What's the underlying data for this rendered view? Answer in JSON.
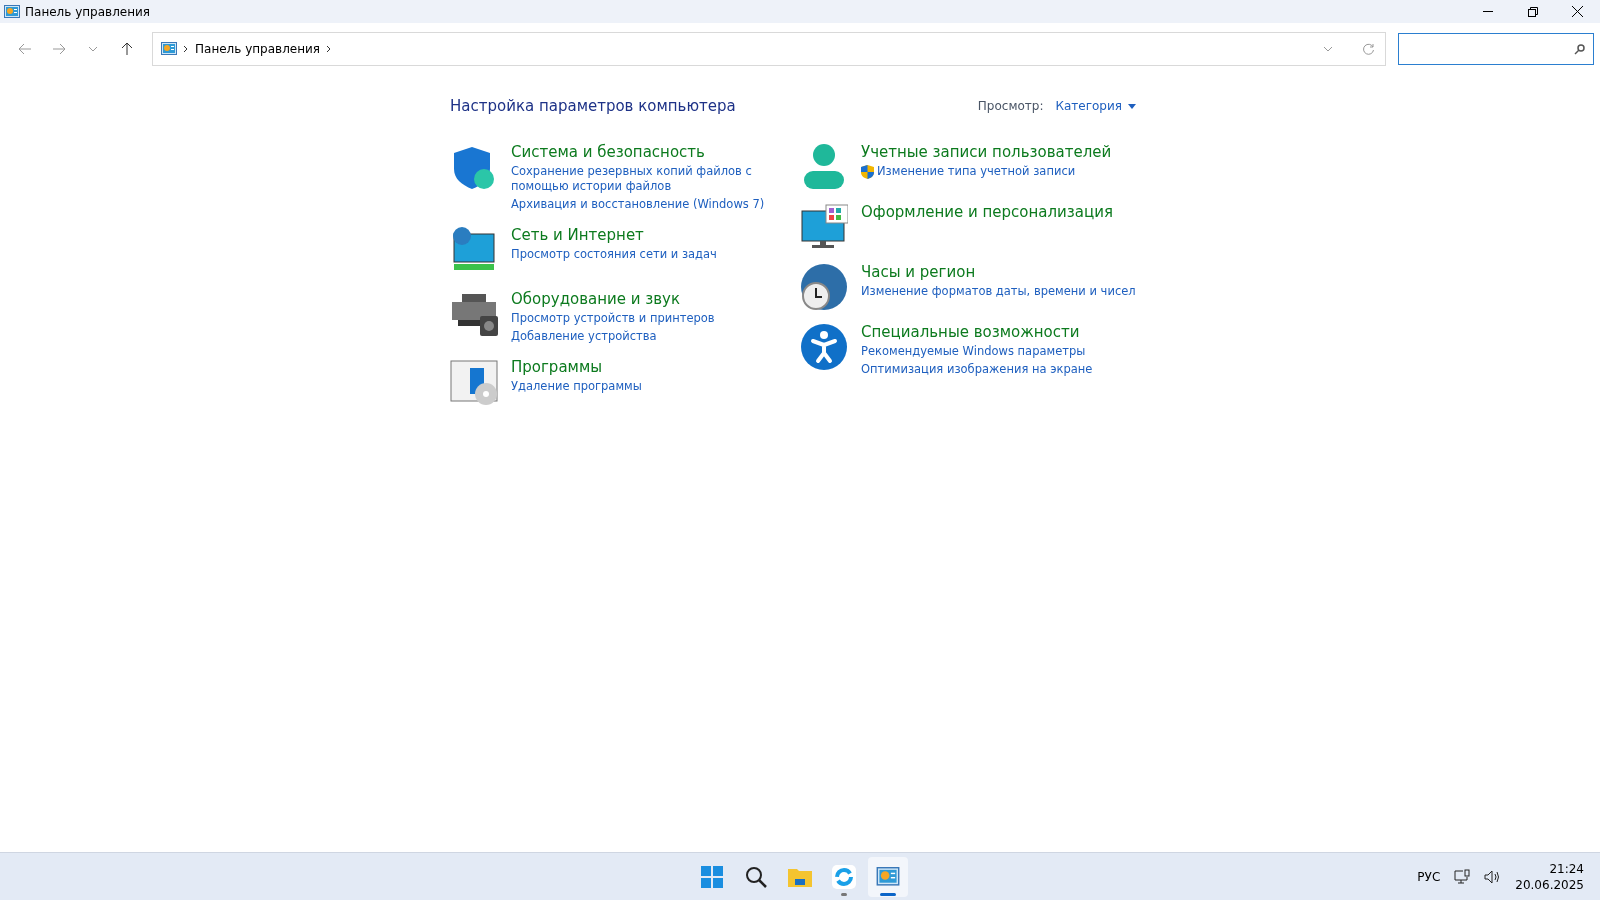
{
  "window": {
    "title": "Панель управления"
  },
  "address_bar": {
    "crumbs": [
      "Панель управления"
    ]
  },
  "heading": "Настройка параметров компьютера",
  "view": {
    "label": "Просмотр:",
    "value": "Категория"
  },
  "columns": [
    [
      {
        "title": "Система и безопасность",
        "links": [
          {
            "text": "Сохранение резервных копий файлов с помощью истории файлов",
            "shield": false
          },
          {
            "text": "Архивация и восстановление (Windows 7)",
            "shield": false
          }
        ]
      },
      {
        "title": "Сеть и Интернет",
        "links": [
          {
            "text": "Просмотр состояния сети и задач",
            "shield": false
          }
        ]
      },
      {
        "title": "Оборудование и звук",
        "links": [
          {
            "text": "Просмотр устройств и принтеров",
            "shield": false
          },
          {
            "text": "Добавление устройства",
            "shield": false
          }
        ]
      },
      {
        "title": "Программы",
        "links": [
          {
            "text": "Удаление программы",
            "shield": false
          }
        ]
      }
    ],
    [
      {
        "title": "Учетные записи пользователей",
        "links": [
          {
            "text": "Изменение типа учетной записи",
            "shield": true
          }
        ]
      },
      {
        "title": "Оформление и персонализация"
      },
      {
        "title": "Часы и регион",
        "links": [
          {
            "text": "Изменение форматов даты, времени и чисел",
            "shield": false
          }
        ]
      },
      {
        "title": "Специальные возможности",
        "links": [
          {
            "text": "Рекомендуемые Windows параметры",
            "shield": false
          },
          {
            "text": "Оптимизация изображения на экране",
            "shield": false
          }
        ]
      }
    ]
  ],
  "taskbar": {
    "apps": [
      {
        "running": false,
        "selected": false
      },
      {
        "running": false,
        "selected": false
      },
      {
        "running": false,
        "selected": false
      },
      {
        "running": true,
        "selected": false
      },
      {
        "running": true,
        "selected": true
      }
    ],
    "language": "РУС",
    "time": "21:24",
    "date": "20.06.2025"
  }
}
